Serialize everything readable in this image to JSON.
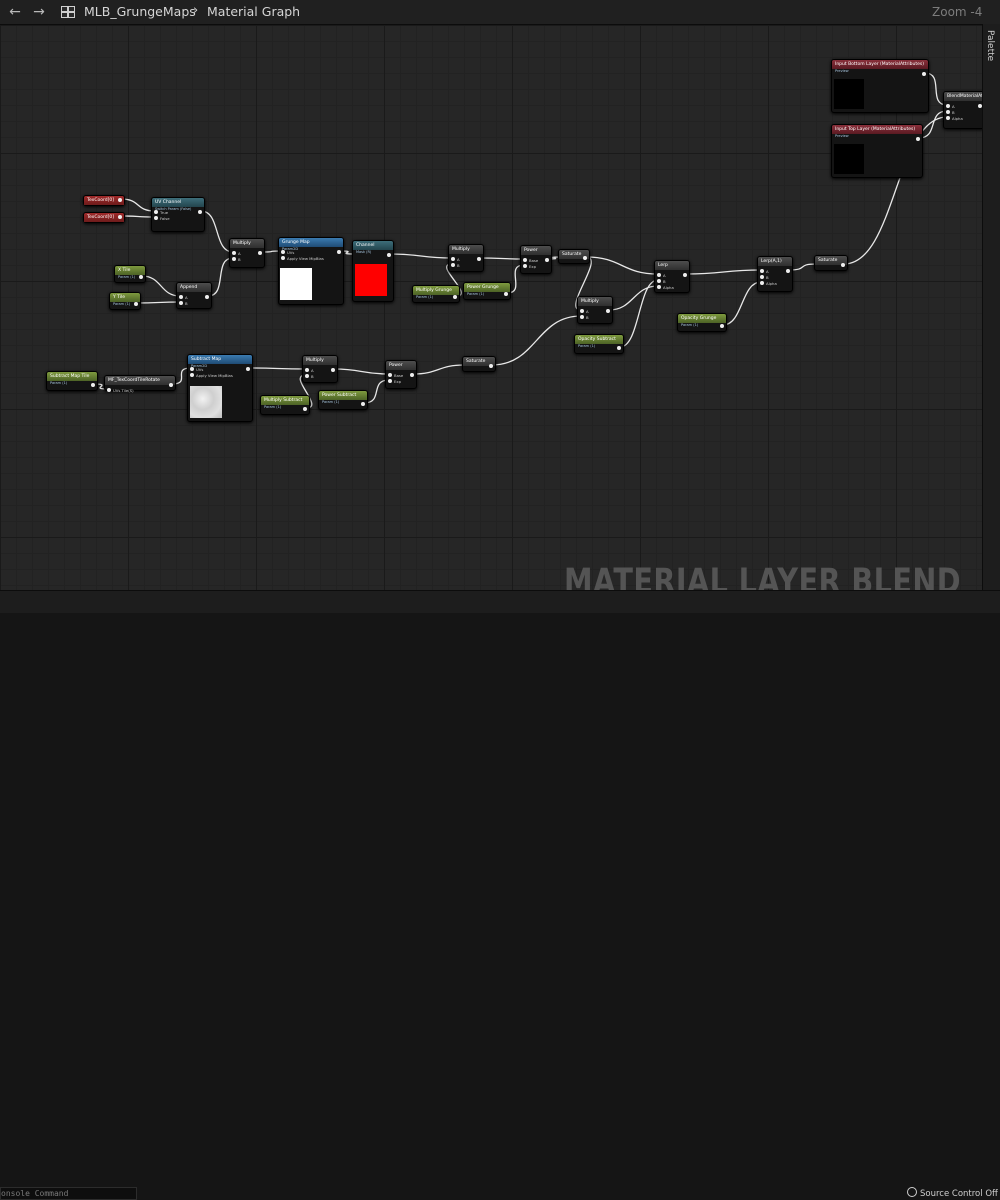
{
  "toolbar": {
    "back_icon": "arrow-left-icon",
    "forward_icon": "arrow-right-icon",
    "asset_icon": "material-graph-icon",
    "breadcrumb_root": "MLB_GrungeMaps",
    "breadcrumb_separator": "›",
    "breadcrumb_leaf": "Material Graph",
    "zoom": "Zoom -4"
  },
  "palette": {
    "label": "Palette"
  },
  "watermark": "MATERIAL LAYER BLEND",
  "console": {
    "placeholder": "onsole Command"
  },
  "status": {
    "source_control": "Source Control Off"
  },
  "colors": {
    "canvas": "#262626",
    "texture_sample_red": "#ff0000",
    "texture_sample_white": "#ffffff"
  },
  "nodes": [
    {
      "id": "texcoord1",
      "title": "TexCoord[0]",
      "sub": "",
      "hd": "red"
    },
    {
      "id": "texcoord2",
      "title": "TexCoord[0]",
      "sub": "",
      "hd": "red"
    },
    {
      "id": "uvchannel",
      "title": "UV Channel",
      "sub": "Switch Param (False)",
      "hd": "teal",
      "pins": [
        "True",
        "False"
      ]
    },
    {
      "id": "tiling1",
      "title": "X Tile",
      "sub": "Param (1)",
      "hd": "green"
    },
    {
      "id": "tiling2",
      "title": "Y Tile",
      "sub": "Param (1)",
      "hd": "green"
    },
    {
      "id": "append",
      "title": "Append",
      "sub": "",
      "hd": "grey",
      "pins": [
        "A",
        "B"
      ]
    },
    {
      "id": "multiply1",
      "title": "Multiply",
      "sub": "",
      "hd": "grey",
      "pins": [
        "A",
        "B"
      ]
    },
    {
      "id": "grunge",
      "title": "Grunge Map",
      "sub": "Param2D",
      "hd": "blue",
      "pins": [
        "UVs",
        "Apply View MipBias"
      ]
    },
    {
      "id": "channel",
      "title": "Channel",
      "sub": "Mask (R)",
      "hd": "teal"
    },
    {
      "id": "multiply2",
      "title": "Multiply",
      "sub": "",
      "hd": "grey",
      "pins": [
        "A",
        "B"
      ]
    },
    {
      "id": "mulgrunge",
      "title": "Multiply Grunge",
      "sub": "Param (1)",
      "hd": "green"
    },
    {
      "id": "powergrunge",
      "title": "Power Grunge",
      "sub": "Param (1)",
      "hd": "green"
    },
    {
      "id": "power1",
      "title": "Power",
      "sub": "",
      "hd": "grey",
      "pins": [
        "Base",
        "Exp"
      ]
    },
    {
      "id": "saturate1",
      "title": "Saturate",
      "sub": "",
      "hd": "grey"
    },
    {
      "id": "multiply3",
      "title": "Multiply",
      "sub": "",
      "hd": "grey",
      "pins": [
        "A",
        "B"
      ]
    },
    {
      "id": "opacitysub",
      "title": "Opacity Subtract",
      "sub": "Param (1)",
      "hd": "green"
    },
    {
      "id": "lerp1",
      "title": "Lerp",
      "sub": "",
      "hd": "grey",
      "pins": [
        "A",
        "B",
        "Alpha"
      ]
    },
    {
      "id": "opacitygrunge",
      "title": "Opacity Grunge",
      "sub": "Param (1)",
      "hd": "green"
    },
    {
      "id": "lerp2",
      "title": "Lerp(A,1)",
      "sub": "",
      "hd": "grey",
      "pins": [
        "A",
        "B",
        "Alpha"
      ]
    },
    {
      "id": "saturate2",
      "title": "Saturate",
      "sub": "",
      "hd": "grey"
    },
    {
      "id": "subtractmapsize",
      "title": "Subtract Map Tile",
      "sub": "Param (1)",
      "hd": "green"
    },
    {
      "id": "tiling3",
      "title": "MF_TexCoordTileRotate",
      "sub": "",
      "hd": "grey",
      "pins": [
        "UVs Tile(S)"
      ]
    },
    {
      "id": "subtractmap",
      "title": "Subtract Map",
      "sub": "Param2D",
      "hd": "blue",
      "pins": [
        "UVs",
        "Apply View MipBias"
      ]
    },
    {
      "id": "multiply4",
      "title": "Multiply",
      "sub": "",
      "hd": "grey",
      "pins": [
        "A",
        "B"
      ]
    },
    {
      "id": "mulsubtract",
      "title": "Multiply Subtract",
      "sub": "Param (1)",
      "hd": "green"
    },
    {
      "id": "powersubtract",
      "title": "Power Subtract",
      "sub": "Param (1)",
      "hd": "green"
    },
    {
      "id": "power2",
      "title": "Power",
      "sub": "",
      "hd": "grey",
      "pins": [
        "Base",
        "Exp"
      ]
    },
    {
      "id": "saturate3",
      "title": "Saturate",
      "sub": "",
      "hd": "grey"
    },
    {
      "id": "bottomlayer",
      "title": "Input Bottom Layer (MaterialAttributes)",
      "sub": "Preview",
      "hd": "darkred"
    },
    {
      "id": "toplayer",
      "title": "Input Top Layer (MaterialAttributes)",
      "sub": "Preview",
      "hd": "darkred"
    },
    {
      "id": "blend",
      "title": "BlendMaterialAttributes",
      "sub": "",
      "hd": "grey",
      "pins": [
        "A",
        "B",
        "Alpha"
      ]
    }
  ]
}
